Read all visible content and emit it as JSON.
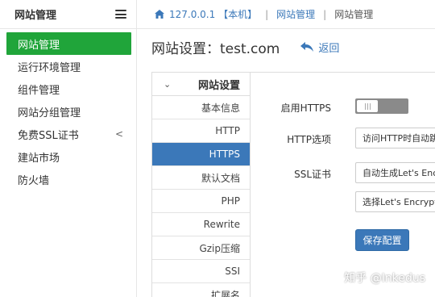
{
  "sidebar": {
    "title": "网站管理",
    "items": [
      {
        "label": "网站管理",
        "active": true
      },
      {
        "label": "运行环境管理"
      },
      {
        "label": "组件管理"
      },
      {
        "label": "网站分组管理"
      },
      {
        "label": "免费SSL证书",
        "caret": "<"
      },
      {
        "label": "建站市场"
      },
      {
        "label": "防火墙"
      }
    ]
  },
  "breadcrumb": {
    "host": "127.0.0.1 【本机】",
    "section": "网站管理",
    "current": "网站管理"
  },
  "page": {
    "title": "网站设置：test.com",
    "back_label": "返回"
  },
  "tabs": {
    "group_label": "网站设置",
    "items": [
      {
        "label": "基本信息"
      },
      {
        "label": "HTTP"
      },
      {
        "label": "HTTPS",
        "active": true
      },
      {
        "label": "默认文档"
      },
      {
        "label": "PHP"
      },
      {
        "label": "Rewrite"
      },
      {
        "label": "Gzip压缩"
      },
      {
        "label": "SSI"
      },
      {
        "label": "扩展名"
      }
    ]
  },
  "form": {
    "enable_https_label": "启用HTTPS",
    "http_option_label": "HTTP选项",
    "http_option_value": "访问HTTP时自动跳",
    "ssl_label": "SSL证书",
    "ssl_value": "自动生成Let's Enc",
    "ssl_select_value": "选择Let's Encrypt",
    "save_label": "保存配置"
  },
  "watermark": "知乎 @Inkedus",
  "colors": {
    "accent_green": "#20a53a",
    "accent_blue": "#3b78b9"
  }
}
